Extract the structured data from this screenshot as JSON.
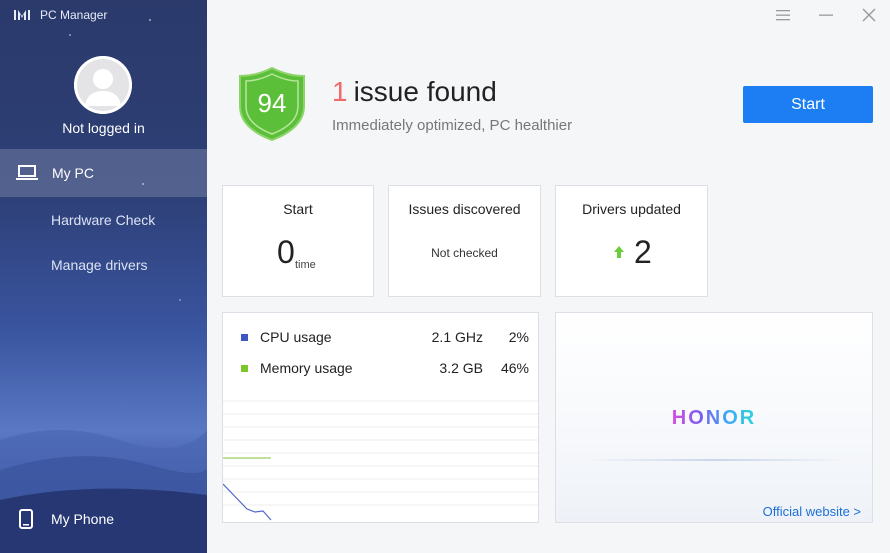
{
  "app": {
    "title": "PC Manager"
  },
  "sidebar": {
    "user_name": "Not logged in",
    "nav": {
      "my_pc": "My PC",
      "hardware_check": "Hardware Check",
      "manage_drivers": "Manage drivers",
      "my_phone": "My Phone"
    }
  },
  "header": {
    "score": "94",
    "issue_count": "1",
    "issue_text": "issue found",
    "subtitle": "Immediately optimized, PC healthier",
    "start_button": "Start"
  },
  "cards": {
    "start": {
      "title": "Start",
      "value": "0",
      "unit": "time"
    },
    "issues": {
      "title": "Issues discovered",
      "status": "Not checked"
    },
    "drivers": {
      "title": "Drivers updated",
      "value": "2"
    }
  },
  "usage": {
    "cpu": {
      "label": "CPU usage",
      "speed": "2.1 GHz",
      "percent": "2%",
      "color": "#3f57c6"
    },
    "memory": {
      "label": "Memory usage",
      "amount": "3.2 GB",
      "percent": "46%",
      "color": "#7fc42b"
    }
  },
  "promo": {
    "brand": "HONOR",
    "link": "Official website >"
  },
  "colors": {
    "accent": "#1d7df2",
    "shield": "#5cbf3a",
    "issue": "#f06a6a"
  }
}
